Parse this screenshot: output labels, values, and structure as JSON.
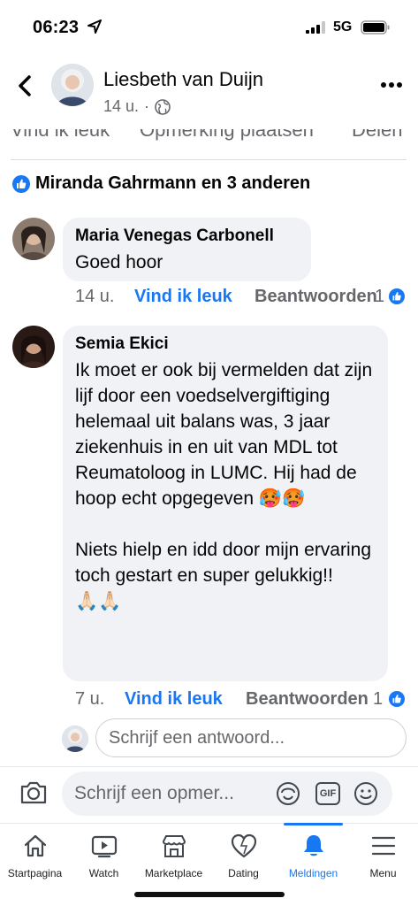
{
  "status_bar": {
    "time": "06:23",
    "network": "5G"
  },
  "header": {
    "author": "Liesbeth van Duijn",
    "time_ago": "14 u.",
    "separator": "·"
  },
  "post_actions": {
    "like": "Vind ik leuk",
    "comment": "Opmerking plaatsen",
    "share": "Delen"
  },
  "reactions": {
    "summary": "Miranda Gahrmann en 3 anderen"
  },
  "comments": [
    {
      "name": "Maria Venegas Carbonell",
      "text": "Goed hoor",
      "time": "14 u.",
      "like_label": "Vind ik leuk",
      "reply_label": "Beantwoorden",
      "reaction_count": "1"
    },
    {
      "name": "Semia Ekici",
      "text": "Ik moet er ook bij vermelden dat zijn lijf door een voedselvergiftiging helemaal uit balans was, 3 jaar ziekenhuis in en uit van MDL tot Reumatoloog in LUMC. Hij had de hoop echt opgegeven 🥵🥵\n\nNiets hielp en idd door mijn ervaring toch gestart en super gelukkig!!\n🙏🏻🙏🏻",
      "time": "7 u.",
      "like_label": "Vind ik leuk",
      "reply_label": "Beantwoorden",
      "reaction_count": "1"
    }
  ],
  "reply_input": {
    "placeholder": "Schrijf een antwoord..."
  },
  "composer": {
    "placeholder": "Schrijf een opmer...",
    "gif_label": "GIF"
  },
  "tabs": [
    {
      "label": "Startpagina",
      "icon": "home-icon"
    },
    {
      "label": "Watch",
      "icon": "watch-icon"
    },
    {
      "label": "Marketplace",
      "icon": "marketplace-icon"
    },
    {
      "label": "Dating",
      "icon": "dating-icon"
    },
    {
      "label": "Meldingen",
      "icon": "bell-icon",
      "active": true
    },
    {
      "label": "Menu",
      "icon": "menu-icon"
    }
  ],
  "colors": {
    "accent": "#1877f2",
    "bubble": "#f0f2f5",
    "secondary_text": "#65676b"
  }
}
